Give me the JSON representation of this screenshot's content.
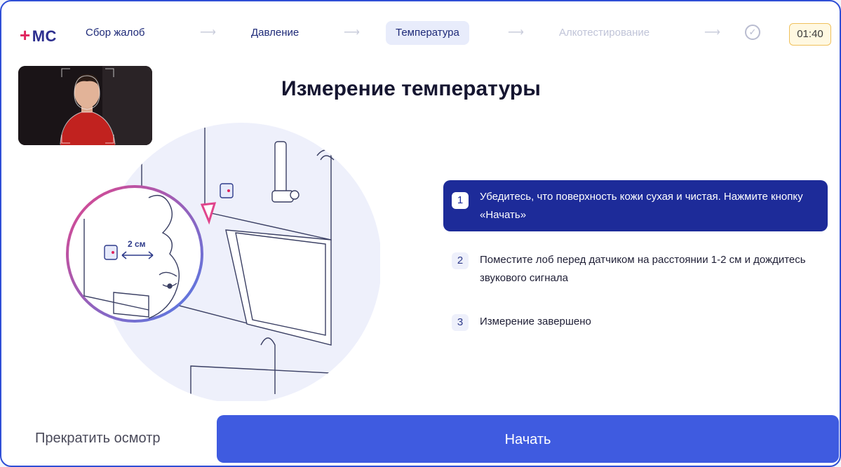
{
  "logo": {
    "plus": "+",
    "text": "МС"
  },
  "steps": [
    {
      "label": "Сбор жалоб",
      "state": "done"
    },
    {
      "label": "Давление",
      "state": "done"
    },
    {
      "label": "Температура",
      "state": "active"
    },
    {
      "label": "Алкотестирование",
      "state": "pending"
    }
  ],
  "arrow_glyph": "⟶",
  "check_glyph": "✓",
  "timer": "01:40",
  "title": "Измерение температуры",
  "illustration": {
    "distance_label": "2 см"
  },
  "instructions": [
    {
      "num": "1",
      "text": "Убедитесь, что поверхность кожи сухая и чистая. Нажмите кнопку «Начать»",
      "active": true
    },
    {
      "num": "2",
      "text": "Поместите лоб перед датчиком на расстоянии 1-2 см и дождитесь звукового сигнала",
      "active": false
    },
    {
      "num": "3",
      "text": "Измерение завершено",
      "active": false
    }
  ],
  "buttons": {
    "stop": "Прекратить осмотр",
    "start": "Начать"
  },
  "colors": {
    "accent": "#3f5be0",
    "active_step_bg": "#1d2b99",
    "timer_border": "#f0c15c",
    "logo_plus": "#e0245e"
  }
}
